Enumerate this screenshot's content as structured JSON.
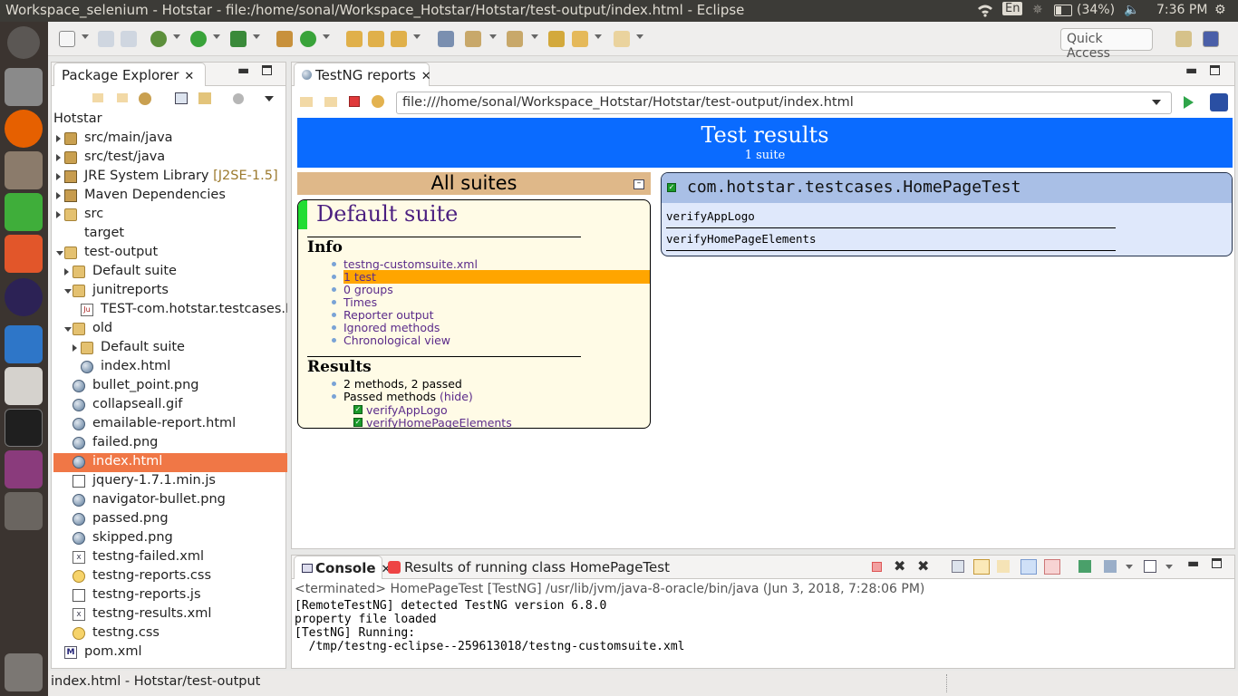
{
  "topbar": {
    "title": "Workspace_selenium - Hotstar - file:/home/sonal/Workspace_Hotstar/Hotstar/test-output/index.html - Eclipse",
    "lang": "En",
    "battery": "(34%)",
    "time": "7:36 PM"
  },
  "quick_access": "Quick Access",
  "package_explorer": {
    "tab": "Package Explorer",
    "project": "Hotstar",
    "items": [
      {
        "label": "src/main/java",
        "icon": "package-folder-icon"
      },
      {
        "label": "src/test/java",
        "icon": "package-folder-icon"
      },
      {
        "label": "JRE System Library",
        "suffix": "[J2SE-1.5]",
        "icon": "library-icon"
      },
      {
        "label": "Maven Dependencies",
        "icon": "library-icon"
      },
      {
        "label": "src",
        "icon": "folder-icon"
      },
      {
        "label": "target",
        "icon": "folder-icon"
      },
      {
        "label": "test-output",
        "icon": "folder-icon"
      },
      {
        "label": "Default suite",
        "icon": "folder-icon"
      },
      {
        "label": "junitreports",
        "icon": "folder-icon"
      },
      {
        "label": "TEST-com.hotstar.testcases.HomePageTest.xml",
        "icon": "junit-file-icon"
      },
      {
        "label": "old",
        "icon": "folder-icon"
      },
      {
        "label": "Default suite",
        "icon": "folder-icon"
      },
      {
        "label": "index.html",
        "icon": "web-page-icon"
      },
      {
        "label": "bullet_point.png",
        "icon": "image-file-icon"
      },
      {
        "label": "collapseall.gif",
        "icon": "image-file-icon"
      },
      {
        "label": "emailable-report.html",
        "icon": "web-page-icon"
      },
      {
        "label": "failed.png",
        "icon": "image-file-icon"
      },
      {
        "label": "index.html",
        "icon": "web-page-icon"
      },
      {
        "label": "jquery-1.7.1.min.js",
        "icon": "js-file-icon"
      },
      {
        "label": "navigator-bullet.png",
        "icon": "image-file-icon"
      },
      {
        "label": "passed.png",
        "icon": "image-file-icon"
      },
      {
        "label": "skipped.png",
        "icon": "image-file-icon"
      },
      {
        "label": "testng-failed.xml",
        "icon": "xml-file-icon"
      },
      {
        "label": "testng-reports.css",
        "icon": "css-file-icon"
      },
      {
        "label": "testng-reports.js",
        "icon": "js-file-icon"
      },
      {
        "label": "testng-results.xml",
        "icon": "xml-file-icon"
      },
      {
        "label": "testng.css",
        "icon": "css-file-icon"
      },
      {
        "label": "pom.xml",
        "icon": "pom-file-icon"
      }
    ]
  },
  "testng": {
    "tab": "TestNG reports",
    "url": "file:///home/sonal/Workspace_Hotstar/Hotstar/test-output/index.html",
    "banner_title": "Test results",
    "banner_sub": "1 suite",
    "all_suites": "All suites",
    "suite_name": "Default suite",
    "info_heading": "Info",
    "info_links": [
      "testng-customsuite.xml",
      "1 test",
      "0 groups",
      "Times",
      "Reporter output",
      "Ignored methods",
      "Chronological view"
    ],
    "results_heading": "Results",
    "results_summary": "2 methods, 2 passed",
    "passed_label": "Passed methods",
    "hide_label": "(hide)",
    "passed_methods": [
      "verifyAppLogo",
      "verifyHomePageElements"
    ],
    "class_name": "com.hotstar.testcases.HomePageTest",
    "class_methods": [
      "verifyAppLogo",
      "verifyHomePageElements"
    ]
  },
  "console": {
    "tab": "Console",
    "tab2": "Results of running class HomePageTest",
    "terminated": "<terminated> HomePageTest [TestNG] /usr/lib/jvm/java-8-oracle/bin/java (Jun 3, 2018, 7:28:06 PM)",
    "lines": [
      "[RemoteTestNG] detected TestNG version 6.8.0",
      "property file loaded",
      "[TestNG] Running:",
      "  /tmp/testng-eclipse--259613018/testng-customsuite.xml"
    ]
  },
  "status": "index.html - Hotstar/test-output"
}
